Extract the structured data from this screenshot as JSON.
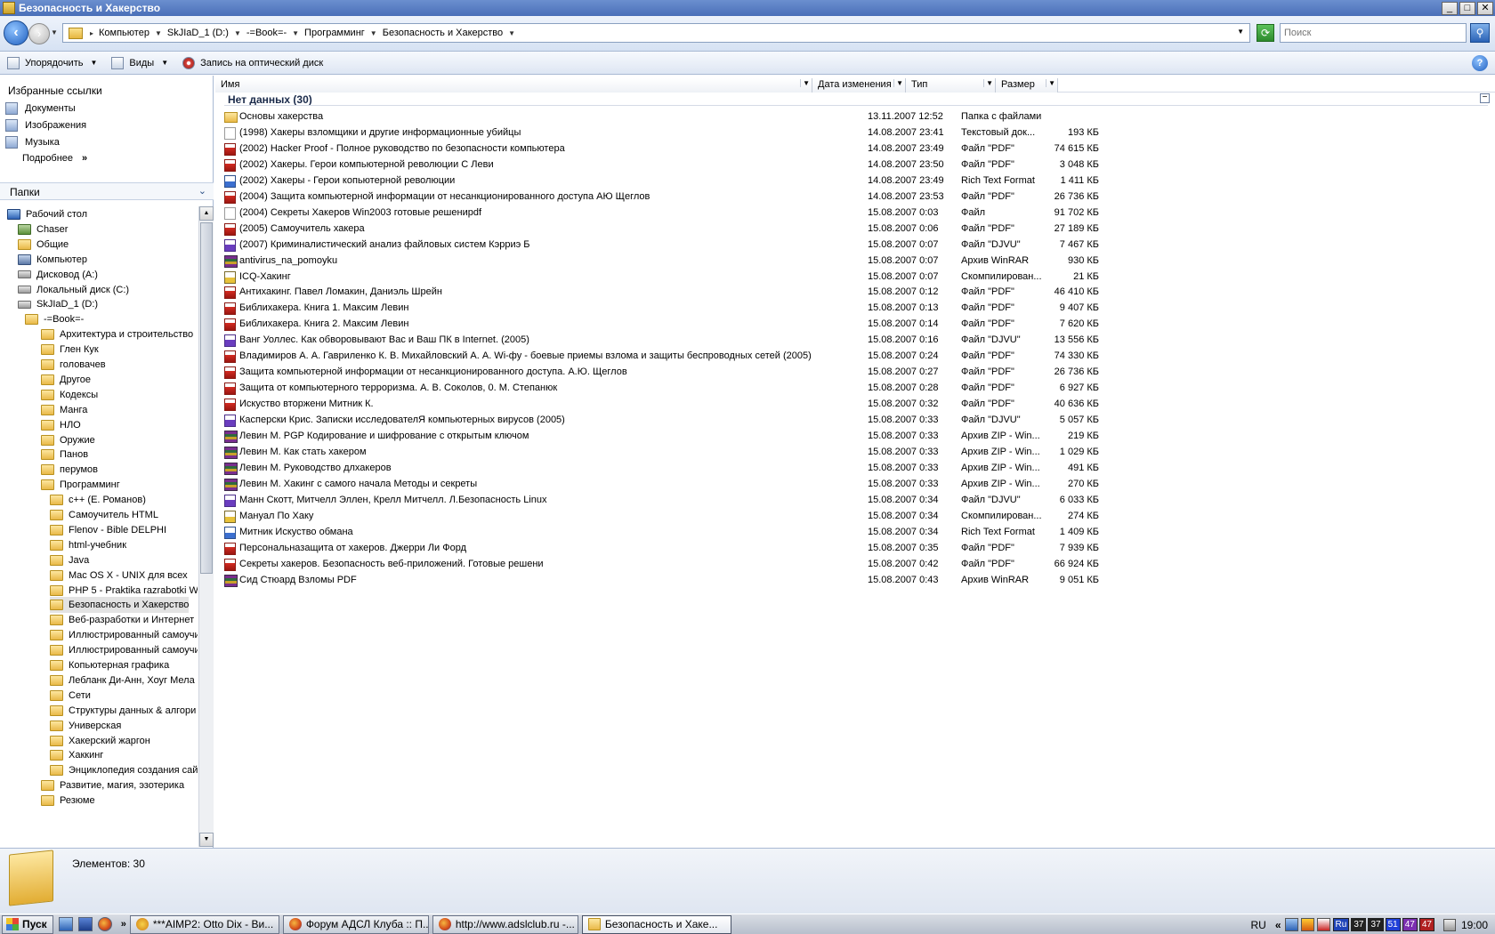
{
  "window": {
    "title": "Безопасность и Хакерство",
    "controls": {
      "minimize": "_",
      "maximize": "□",
      "close": "✕"
    }
  },
  "address_bar": {
    "breadcrumbs": [
      "Компьютер",
      "SkJIaD_1 (D:)",
      "-=Book=-",
      "Программинг",
      "Безопасность и Хакерство"
    ],
    "search_placeholder": "Поиск"
  },
  "toolbar": {
    "organize": "Упорядочить",
    "views": "Виды",
    "burn": "Запись на оптический диск",
    "help": "?"
  },
  "favorites": {
    "title": "Избранные ссылки",
    "items": [
      "Документы",
      "Изображения",
      "Музыка"
    ],
    "more": "Подробнее",
    "more_chevron": "»"
  },
  "folders": {
    "title": "Папки",
    "tree": [
      {
        "label": "Рабочий стол",
        "icon": "desktop",
        "level": 0
      },
      {
        "label": "Chaser",
        "icon": "user",
        "level": 1
      },
      {
        "label": "Общие",
        "icon": "folder",
        "level": 1
      },
      {
        "label": "Компьютер",
        "icon": "computer",
        "level": 1
      },
      {
        "label": "Дисковод (A:)",
        "icon": "drive",
        "level": 2
      },
      {
        "label": "Локальный диск (C:)",
        "icon": "drive",
        "level": 2
      },
      {
        "label": "SkJIaD_1 (D:)",
        "icon": "drive",
        "level": 2
      },
      {
        "label": "-=Book=-",
        "icon": "folder",
        "level": 3
      },
      {
        "label": "Архитектура и строительство",
        "icon": "folder",
        "level": 4
      },
      {
        "label": "Глен Кук",
        "icon": "folder",
        "level": 4
      },
      {
        "label": "головачев",
        "icon": "folder",
        "level": 4
      },
      {
        "label": "Другое",
        "icon": "folder",
        "level": 4
      },
      {
        "label": "Кодексы",
        "icon": "folder",
        "level": 4
      },
      {
        "label": "Манга",
        "icon": "folder",
        "level": 4
      },
      {
        "label": "НЛО",
        "icon": "folder",
        "level": 4
      },
      {
        "label": "Оружие",
        "icon": "folder",
        "level": 4
      },
      {
        "label": "Панов",
        "icon": "folder",
        "level": 4
      },
      {
        "label": "перумов",
        "icon": "folder",
        "level": 4
      },
      {
        "label": "Программинг",
        "icon": "folder",
        "level": 4
      },
      {
        "label": "c++ (Е. Романов)",
        "icon": "folder",
        "level": 5
      },
      {
        "label": "Самоучитель HTML",
        "icon": "folder",
        "level": 5
      },
      {
        "label": "Flenov - Bible DELPHI",
        "icon": "folder",
        "level": 5
      },
      {
        "label": "html-учебник",
        "icon": "folder",
        "level": 5
      },
      {
        "label": "Java",
        "icon": "folder",
        "level": 5
      },
      {
        "label": "Mac OS X - UNIX для всех",
        "icon": "folder",
        "level": 5
      },
      {
        "label": "PHP 5 - Praktika razrabotki We",
        "icon": "folder",
        "level": 5
      },
      {
        "label": "Безопасность и Хакерство",
        "icon": "folder",
        "level": 5,
        "selected": true
      },
      {
        "label": "Веб-разработки и Интернет",
        "icon": "folder",
        "level": 5
      },
      {
        "label": "Иллюстрированный самоучи",
        "icon": "folder",
        "level": 5
      },
      {
        "label": "Иллюстрированный самоучи",
        "icon": "folder",
        "level": 5
      },
      {
        "label": "Копьютерная графика",
        "icon": "folder",
        "level": 5
      },
      {
        "label": "Лебланк Ди-Анн, Хоуг Мела",
        "icon": "folder",
        "level": 5
      },
      {
        "label": "Сети",
        "icon": "folder",
        "level": 5
      },
      {
        "label": "Структуры данных & алгори",
        "icon": "folder",
        "level": 5
      },
      {
        "label": "Универская",
        "icon": "folder",
        "level": 5
      },
      {
        "label": "Хакерский жаргон",
        "icon": "folder",
        "level": 5
      },
      {
        "label": "Хаккинг",
        "icon": "folder",
        "level": 5
      },
      {
        "label": "Энциклопедия создания сай",
        "icon": "folder",
        "level": 5
      },
      {
        "label": "Развитие, магия, эзотерика",
        "icon": "folder",
        "level": 4
      },
      {
        "label": "Резюме",
        "icon": "folder",
        "level": 4
      }
    ]
  },
  "columns": {
    "name": "Имя",
    "date": "Дата изменения",
    "type": "Тип",
    "size": "Размер"
  },
  "group": {
    "title": "Нет данных (30)",
    "collapse": "−"
  },
  "files": [
    {
      "icon": "folder",
      "name": "Основы хакерства",
      "date": "13.11.2007 12:52",
      "type": "Папка с файлами",
      "size": ""
    },
    {
      "icon": "txt",
      "name": "(1998) Хакеры взломщики и другие информационные убийцы",
      "date": "14.08.2007 23:41",
      "type": "Текстовый док...",
      "size": "193 КБ"
    },
    {
      "icon": "pdf",
      "name": "(2002) Hacker Proof - Полное руководство по безопасности компьютера",
      "date": "14.08.2007 23:49",
      "type": "Файл \"PDF\"",
      "size": "74 615 КБ"
    },
    {
      "icon": "pdf",
      "name": "(2002) Хакеры. Герои компьютерной революции С Леви",
      "date": "14.08.2007 23:50",
      "type": "Файл \"PDF\"",
      "size": "3 048 КБ"
    },
    {
      "icon": "rtf",
      "name": "(2002) Хакеры - Герои копьютерной революции",
      "date": "14.08.2007 23:49",
      "type": "Rich Text Format",
      "size": "1 411 КБ"
    },
    {
      "icon": "pdf",
      "name": "(2004) Защита компьютерной информации от несанкционированного доступа АЮ Щеглов",
      "date": "14.08.2007 23:53",
      "type": "Файл \"PDF\"",
      "size": "26 736 КБ"
    },
    {
      "icon": "blank",
      "name": "(2004) Секреты Хакеров Win2003 готовые решенирdf",
      "date": "15.08.2007 0:03",
      "type": "Файл",
      "size": "91 702 КБ"
    },
    {
      "icon": "pdf",
      "name": "(2005) Самоучитель хакера",
      "date": "15.08.2007 0:06",
      "type": "Файл \"PDF\"",
      "size": "27 189 КБ"
    },
    {
      "icon": "djvu",
      "name": "(2007) Криминалистический анализ файловых систем Кэрриэ Б",
      "date": "15.08.2007 0:07",
      "type": "Файл \"DJVU\"",
      "size": "7 467 КБ"
    },
    {
      "icon": "rar",
      "name": "antivirus_na_pomoyku",
      "date": "15.08.2007 0:07",
      "type": "Архив WinRAR",
      "size": "930 КБ"
    },
    {
      "icon": "chm",
      "name": "ICQ-Хакинг",
      "date": "15.08.2007 0:07",
      "type": "Скомпилирован...",
      "size": "21 КБ"
    },
    {
      "icon": "pdf",
      "name": "Антихакинг. Павел Ломакин, Даниэль Шрейн",
      "date": "15.08.2007 0:12",
      "type": "Файл \"PDF\"",
      "size": "46 410 КБ"
    },
    {
      "icon": "pdf",
      "name": "Библихакера. Книга 1. Максим Левин",
      "date": "15.08.2007 0:13",
      "type": "Файл \"PDF\"",
      "size": "9 407 КБ"
    },
    {
      "icon": "pdf",
      "name": "Библихакера. Книга 2. Максим Левин",
      "date": "15.08.2007 0:14",
      "type": "Файл \"PDF\"",
      "size": "7 620 КБ"
    },
    {
      "icon": "djvu",
      "name": "Ванг Уоллес. Как обворовывают Вас и Ваш ПК в Internet. (2005)",
      "date": "15.08.2007 0:16",
      "type": "Файл \"DJVU\"",
      "size": "13 556 КБ"
    },
    {
      "icon": "pdf",
      "name": "Владимиров А. А. Гавриленко К. В. Михайловский А. А. Wi-фу - боевые приемы взлома и защиты беспроводных сетей (2005)",
      "date": "15.08.2007 0:24",
      "type": "Файл \"PDF\"",
      "size": "74 330 КБ"
    },
    {
      "icon": "pdf",
      "name": "Защита компьютерной информации от несанкционированного доступа. А.Ю. Щеглов",
      "date": "15.08.2007 0:27",
      "type": "Файл \"PDF\"",
      "size": "26 736 КБ"
    },
    {
      "icon": "pdf",
      "name": "Защита от компьютерного терроризма. А. В. Соколов, 0. М. Степанюк",
      "date": "15.08.2007 0:28",
      "type": "Файл \"PDF\"",
      "size": "6 927 КБ"
    },
    {
      "icon": "pdf",
      "name": "Искуство вторжени Митник К.",
      "date": "15.08.2007 0:32",
      "type": "Файл \"PDF\"",
      "size": "40 636 КБ"
    },
    {
      "icon": "djvu",
      "name": "Касперски Крис. Записки исследователЯ компьютерных вирусов (2005)",
      "date": "15.08.2007 0:33",
      "type": "Файл \"DJVU\"",
      "size": "5 057 КБ"
    },
    {
      "icon": "rar",
      "name": "Левин М. PGP Кодирование и шифрование с открытым ключом",
      "date": "15.08.2007 0:33",
      "type": "Архив ZIP - Win...",
      "size": "219 КБ"
    },
    {
      "icon": "rar",
      "name": "Левин М. Как стать хакером",
      "date": "15.08.2007 0:33",
      "type": "Архив ZIP - Win...",
      "size": "1 029 КБ"
    },
    {
      "icon": "rar",
      "name": "Левин М. Руководство длхакеров",
      "date": "15.08.2007 0:33",
      "type": "Архив ZIP - Win...",
      "size": "491 КБ"
    },
    {
      "icon": "rar",
      "name": "Левин М. Хакинг с самого начала Методы и секреты",
      "date": "15.08.2007 0:33",
      "type": "Архив ZIP - Win...",
      "size": "270 КБ"
    },
    {
      "icon": "djvu",
      "name": "Манн Скотт, Митчелл Эллен, Крелл  Митчелл. Л.Безопасность Linux",
      "date": "15.08.2007 0:34",
      "type": "Файл \"DJVU\"",
      "size": "6 033 КБ"
    },
    {
      "icon": "chm",
      "name": "Мануал По Хаку",
      "date": "15.08.2007 0:34",
      "type": "Скомпилирован...",
      "size": "274 КБ"
    },
    {
      "icon": "rtf",
      "name": "Митник Искуство обмана",
      "date": "15.08.2007 0:34",
      "type": "Rich Text Format",
      "size": "1 409 КБ"
    },
    {
      "icon": "pdf",
      "name": "Персональназащита от хакеров. Джерри Ли Форд",
      "date": "15.08.2007 0:35",
      "type": "Файл \"PDF\"",
      "size": "7 939 КБ"
    },
    {
      "icon": "pdf",
      "name": "Секреты хакеров. Безопасность веб-приложений. Готовые решени",
      "date": "15.08.2007 0:42",
      "type": "Файл \"PDF\"",
      "size": "66 924 КБ"
    },
    {
      "icon": "rar",
      "name": "Сид Стюард Взломы PDF",
      "date": "15.08.2007 0:43",
      "type": "Архив WinRAR",
      "size": "9 051 КБ"
    }
  ],
  "details": {
    "items_count": "Элементов: 30"
  },
  "taskbar": {
    "start": "Пуск",
    "more": "»",
    "tasks": [
      {
        "label": "***AIMP2: Otto Dix - Ви...",
        "icon": "aimp"
      },
      {
        "label": "Форум АДСЛ Клуба :: П...",
        "icon": "firefox"
      },
      {
        "label": "http://www.adslclub.ru -...",
        "icon": "firefox"
      },
      {
        "label": "Безопасность и Хаке...",
        "icon": "folder",
        "active": true
      }
    ],
    "tray": {
      "lang": "RU",
      "chevron": "«",
      "layout": "Ru",
      "badges": [
        "37",
        "37",
        "51",
        "47",
        "47"
      ],
      "time": "19:00"
    }
  }
}
